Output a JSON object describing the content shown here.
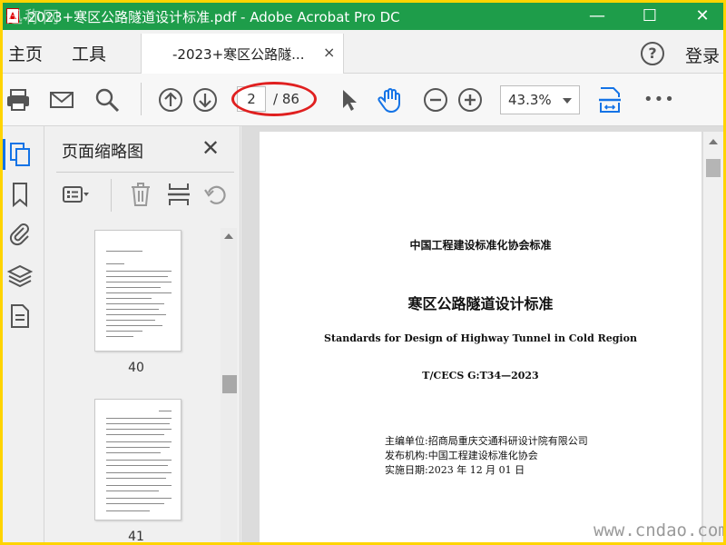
{
  "window": {
    "title": "-2023+寒区公路隧道设计标准.pdf - Adobe Acrobat Pro DC",
    "watermark_overlay": "迅称网",
    "minimize": "—",
    "maximize": "☐",
    "close": "✕"
  },
  "menubar": {
    "home": "主页",
    "tools": "工具",
    "tab_label": "-2023+寒区公路隧...",
    "tab_close": "×",
    "help": "?",
    "login": "登录"
  },
  "toolbar": {
    "current_page": "2",
    "total_pages": "/ 86",
    "zoom": "43.3%",
    "more": "•••"
  },
  "panel": {
    "title": "页面缩略图",
    "close": "✕",
    "thumbnails": [
      {
        "page": "40"
      },
      {
        "page": "41"
      }
    ]
  },
  "document": {
    "org_title": "中国工程建设标准化协会标准",
    "cn_title": "寒区公路隧道设计标准",
    "en_title": "Standards for Design of Highway Tunnel in Cold Region",
    "code": "T/CECS G:T34—2023",
    "editor": "主编单位:招商局重庆交通科研设计院有限公司",
    "publisher": "发布机构:中国工程建设标准化协会",
    "date": "实施日期:2023 年 12 月 01 日"
  },
  "footer": {
    "site_watermark": "www.cndao.com"
  },
  "colors": {
    "titlebar": "#1e9d4a",
    "accent": "#1473e6",
    "annotation": "#e02020",
    "border": "#ffd400"
  }
}
